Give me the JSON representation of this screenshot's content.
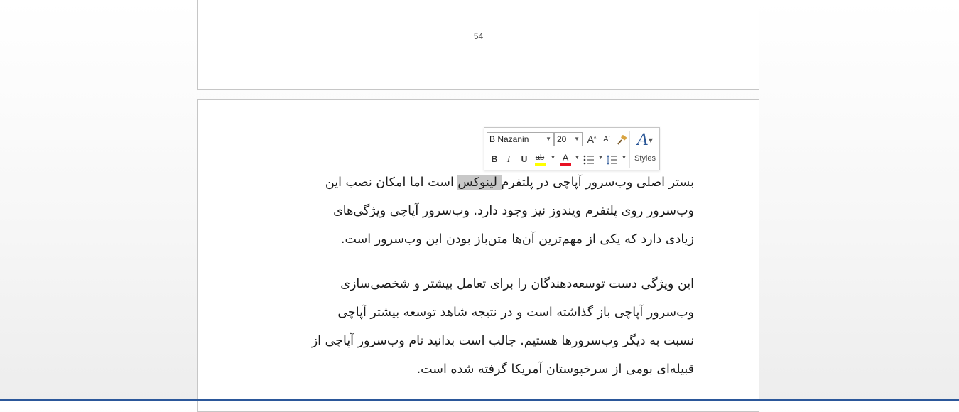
{
  "page_top": {
    "page_number": "54"
  },
  "paragraph_1": {
    "lines": [
      {
        "before": "بستر اصلی وب‌سرور آپاچی در پلتفرم",
        "selected": " لینوکس",
        "after": " است اما امکان نصب این"
      },
      {
        "text": "وب‌سرور روی پلتفرم ویندوز نیز وجود دارد. وب‌سرور آپاچی ویژگی‌های"
      },
      {
        "text": "زیادی دارد که یکی از مهم‌ترین آن‌ها متن‌باز بودن این وب‌سرور است."
      }
    ]
  },
  "paragraph_2": {
    "lines": [
      {
        "text": "این ویژگی دست توسعه‌دهندگان را برای تعامل بیشتر و شخصی‌سازی"
      },
      {
        "text": "وب‌سرور آپاچی باز گذاشته است و در نتیجه شاهد توسعه بیشتر آپاچی"
      },
      {
        "text": "نسبت به دیگر وب‌سرورها هستیم. جالب است بدانید نام وب‌سرور آپاچی از"
      },
      {
        "text": "قبیله‌ای بومی از سرخپوستان آمریکا گرفته شده است."
      }
    ]
  },
  "mini_toolbar": {
    "font_name": "B Nazanin",
    "font_size": "20",
    "grow_font_label": "A",
    "shrink_font_label": "A",
    "bold_label": "B",
    "italic_label": "I",
    "underline_label": "U",
    "highlight_label": "ab",
    "font_color_label": "A",
    "styles_icon_label": "A",
    "styles_label": "Styles",
    "highlight_color": "#ffff00",
    "font_color": "#e81123",
    "styles_color": "#2b5797"
  },
  "icons": [
    "grow-font-icon",
    "shrink-font-icon",
    "format-painter-icon",
    "highlight-icon",
    "font-color-icon",
    "bullets-icon",
    "line-spacing-icon",
    "styles-icon"
  ]
}
